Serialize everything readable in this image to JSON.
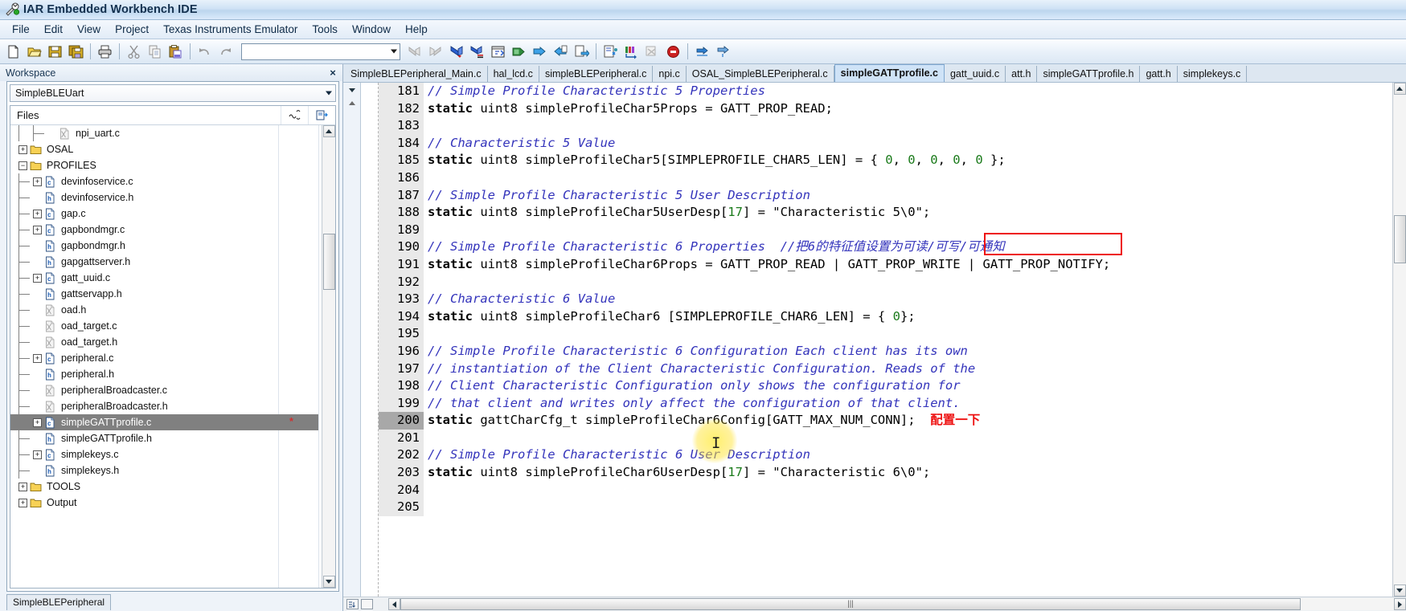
{
  "window": {
    "title": "IAR Embedded Workbench IDE",
    "app_icon": "iar-wrench-icon"
  },
  "menubar": {
    "items": [
      {
        "label": "File"
      },
      {
        "label": "Edit"
      },
      {
        "label": "View"
      },
      {
        "label": "Project"
      },
      {
        "label": "Texas Instruments Emulator"
      },
      {
        "label": "Tools"
      },
      {
        "label": "Window"
      },
      {
        "label": "Help"
      }
    ]
  },
  "toolbar": {
    "combo_value": "",
    "buttons": [
      {
        "name": "new-document-icon"
      },
      {
        "name": "open-folder-icon"
      },
      {
        "name": "save-icon"
      },
      {
        "name": "save-all-icon"
      },
      {
        "name": "print-icon"
      },
      {
        "name": "cut-icon"
      },
      {
        "name": "copy-icon"
      },
      {
        "name": "paste-icon"
      },
      {
        "name": "undo-icon"
      },
      {
        "name": "redo-icon"
      },
      {
        "name": "navigate-back-icon"
      },
      {
        "name": "navigate-forward-icon"
      },
      {
        "name": "go-to-definition-icon"
      },
      {
        "name": "find-in-files-icon"
      },
      {
        "name": "toggle-bookmark-icon"
      },
      {
        "name": "compile-icon"
      },
      {
        "name": "make-icon"
      },
      {
        "name": "rebuild-all-icon"
      },
      {
        "name": "stop-build-icon"
      },
      {
        "name": "debug-without-download-icon"
      },
      {
        "name": "download-and-debug-icon"
      },
      {
        "name": "break-icon"
      },
      {
        "name": "stop-debugging-icon"
      },
      {
        "name": "step-over-icon"
      },
      {
        "name": "step-into-icon"
      }
    ]
  },
  "workspace": {
    "header_label": "Workspace",
    "close_label": "×",
    "selected_workspace": "SimpleBLEUart",
    "files_column_label": "Files",
    "status_tab": "SimpleBLEPeripheral",
    "tree": [
      {
        "label": "npi_uart.c",
        "depth": 3,
        "icon": "excluded-file-icon",
        "expander": "none",
        "connector": "last"
      },
      {
        "label": "OSAL",
        "depth": 1,
        "icon": "folder-icon",
        "expander": "plus",
        "connector": "tee"
      },
      {
        "label": "PROFILES",
        "depth": 1,
        "icon": "folder-icon",
        "expander": "minus",
        "connector": "tee"
      },
      {
        "label": "devinfoservice.c",
        "depth": 2,
        "icon": "c-file-icon",
        "expander": "plus",
        "connector": "tee"
      },
      {
        "label": "devinfoservice.h",
        "depth": 2,
        "icon": "h-file-icon",
        "expander": "none",
        "connector": "tee"
      },
      {
        "label": "gap.c",
        "depth": 2,
        "icon": "c-file-icon",
        "expander": "plus",
        "connector": "tee"
      },
      {
        "label": "gapbondmgr.c",
        "depth": 2,
        "icon": "c-file-icon",
        "expander": "plus",
        "connector": "tee"
      },
      {
        "label": "gapbondmgr.h",
        "depth": 2,
        "icon": "h-file-icon",
        "expander": "none",
        "connector": "tee"
      },
      {
        "label": "gapgattserver.h",
        "depth": 2,
        "icon": "h-file-icon",
        "expander": "none",
        "connector": "tee"
      },
      {
        "label": "gatt_uuid.c",
        "depth": 2,
        "icon": "c-file-icon",
        "expander": "plus",
        "connector": "tee"
      },
      {
        "label": "gattservapp.h",
        "depth": 2,
        "icon": "h-file-icon",
        "expander": "none",
        "connector": "tee"
      },
      {
        "label": "oad.h",
        "depth": 2,
        "icon": "excluded-file-icon",
        "expander": "none",
        "connector": "tee"
      },
      {
        "label": "oad_target.c",
        "depth": 2,
        "icon": "excluded-file-icon",
        "expander": "none",
        "connector": "tee"
      },
      {
        "label": "oad_target.h",
        "depth": 2,
        "icon": "excluded-file-icon",
        "expander": "none",
        "connector": "tee"
      },
      {
        "label": "peripheral.c",
        "depth": 2,
        "icon": "c-file-icon",
        "expander": "plus",
        "connector": "tee"
      },
      {
        "label": "peripheral.h",
        "depth": 2,
        "icon": "h-file-icon",
        "expander": "none",
        "connector": "tee"
      },
      {
        "label": "peripheralBroadcaster.c",
        "depth": 2,
        "icon": "excluded-file-icon",
        "expander": "none",
        "connector": "tee"
      },
      {
        "label": "peripheralBroadcaster.h",
        "depth": 2,
        "icon": "excluded-file-icon",
        "expander": "none",
        "connector": "tee"
      },
      {
        "label": "simpleGATTprofile.c",
        "depth": 2,
        "icon": "c-file-icon",
        "expander": "plus",
        "connector": "tee",
        "selected": true,
        "modified_mark": "*"
      },
      {
        "label": "simpleGATTprofile.h",
        "depth": 2,
        "icon": "h-file-icon",
        "expander": "none",
        "connector": "tee"
      },
      {
        "label": "simplekeys.c",
        "depth": 2,
        "icon": "c-file-icon",
        "expander": "plus",
        "connector": "tee"
      },
      {
        "label": "simplekeys.h",
        "depth": 2,
        "icon": "h-file-icon",
        "expander": "none",
        "connector": "last"
      },
      {
        "label": "TOOLS",
        "depth": 1,
        "icon": "folder-icon",
        "expander": "plus",
        "connector": "tee"
      },
      {
        "label": "Output",
        "depth": 1,
        "icon": "folder-icon",
        "expander": "plus",
        "connector": "last"
      }
    ]
  },
  "editor": {
    "tabs": [
      {
        "label": "SimpleBLEPeripheral_Main.c",
        "active": false
      },
      {
        "label": "hal_lcd.c",
        "active": false
      },
      {
        "label": "simpleBLEPeripheral.c",
        "active": false
      },
      {
        "label": "npi.c",
        "active": false
      },
      {
        "label": "OSAL_SimpleBLEPeripheral.c",
        "active": false
      },
      {
        "label": "simpleGATTprofile.c",
        "active": true
      },
      {
        "label": "gatt_uuid.c",
        "active": false
      },
      {
        "label": "att.h",
        "active": false
      },
      {
        "label": "simpleGATTprofile.h",
        "active": false
      },
      {
        "label": "gatt.h",
        "active": false
      },
      {
        "label": "simplekeys.c",
        "active": false
      }
    ],
    "first_line_number": 181,
    "current_line_number": 200,
    "lines": [
      {
        "n": 181,
        "tokens": [
          {
            "t": "cm",
            "v": "// Simple Profile Characteristic 5 Properties"
          }
        ]
      },
      {
        "n": 182,
        "tokens": [
          {
            "t": "kw",
            "v": "static"
          },
          {
            "t": "pl",
            "v": " uint8 simpleProfileChar5Props = GATT_PROP_READ;"
          }
        ]
      },
      {
        "n": 183,
        "tokens": []
      },
      {
        "n": 184,
        "tokens": [
          {
            "t": "cm",
            "v": "// Characteristic 5 Value"
          }
        ]
      },
      {
        "n": 185,
        "tokens": [
          {
            "t": "kw",
            "v": "static"
          },
          {
            "t": "pl",
            "v": " uint8 simpleProfileChar5[SIMPLEPROFILE_CHAR5_LEN] = { "
          },
          {
            "t": "num",
            "v": "0"
          },
          {
            "t": "pl",
            "v": ", "
          },
          {
            "t": "num",
            "v": "0"
          },
          {
            "t": "pl",
            "v": ", "
          },
          {
            "t": "num",
            "v": "0"
          },
          {
            "t": "pl",
            "v": ", "
          },
          {
            "t": "num",
            "v": "0"
          },
          {
            "t": "pl",
            "v": ", "
          },
          {
            "t": "num",
            "v": "0"
          },
          {
            "t": "pl",
            "v": " };"
          }
        ]
      },
      {
        "n": 186,
        "tokens": []
      },
      {
        "n": 187,
        "tokens": [
          {
            "t": "cm",
            "v": "// Simple Profile Characteristic 5 User Description"
          }
        ]
      },
      {
        "n": 188,
        "tokens": [
          {
            "t": "kw",
            "v": "static"
          },
          {
            "t": "pl",
            "v": " uint8 simpleProfileChar5UserDesp["
          },
          {
            "t": "num",
            "v": "17"
          },
          {
            "t": "pl",
            "v": "] = \"Characteristic 5\\0\";"
          }
        ]
      },
      {
        "n": 189,
        "tokens": []
      },
      {
        "n": 190,
        "tokens": [
          {
            "t": "cm",
            "v": "// Simple Profile Characteristic 6 Properties  //把6的特征值设置为可读/可写/可通知"
          }
        ]
      },
      {
        "n": 191,
        "tokens": [
          {
            "t": "kw",
            "v": "static"
          },
          {
            "t": "pl",
            "v": " uint8 simpleProfileChar6Props = GATT_PROP_READ | GATT_PROP_WRITE | GATT_PROP_NOTIFY;"
          }
        ]
      },
      {
        "n": 192,
        "tokens": []
      },
      {
        "n": 193,
        "tokens": [
          {
            "t": "cm",
            "v": "// Characteristic 6 Value"
          }
        ]
      },
      {
        "n": 194,
        "tokens": [
          {
            "t": "kw",
            "v": "static"
          },
          {
            "t": "pl",
            "v": " uint8 simpleProfileChar6 [SIMPLEPROFILE_CHAR6_LEN] = { "
          },
          {
            "t": "num",
            "v": "0"
          },
          {
            "t": "pl",
            "v": "};"
          }
        ]
      },
      {
        "n": 195,
        "tokens": []
      },
      {
        "n": 196,
        "tokens": [
          {
            "t": "cm",
            "v": "// Simple Profile Characteristic 6 Configuration Each client has its own"
          }
        ]
      },
      {
        "n": 197,
        "tokens": [
          {
            "t": "cm",
            "v": "// instantiation of the Client Characteristic Configuration. Reads of the"
          }
        ]
      },
      {
        "n": 198,
        "tokens": [
          {
            "t": "cm",
            "v": "// Client Characteristic Configuration only shows the configuration for"
          }
        ]
      },
      {
        "n": 199,
        "tokens": [
          {
            "t": "cm",
            "v": "// that client and writes only affect the configuration of that client."
          }
        ]
      },
      {
        "n": 200,
        "tokens": [
          {
            "t": "kw",
            "v": "static"
          },
          {
            "t": "pl",
            "v": " gattCharCfg_t simpleProfileChar6Config[GATT_MAX_NUM_CONN];  "
          },
          {
            "t": "anno",
            "v": "配置一下"
          }
        ]
      },
      {
        "n": 201,
        "tokens": []
      },
      {
        "n": 202,
        "tokens": [
          {
            "t": "cm",
            "v": "// Simple Profile Characteristic 6 User Description"
          }
        ]
      },
      {
        "n": 203,
        "tokens": [
          {
            "t": "kw",
            "v": "static"
          },
          {
            "t": "pl",
            "v": " uint8 simpleProfileChar6UserDesp["
          },
          {
            "t": "num",
            "v": "17"
          },
          {
            "t": "pl",
            "v": "] = \"Characteristic 6\\0\";"
          }
        ]
      },
      {
        "n": 204,
        "tokens": []
      },
      {
        "n": 205,
        "tokens": []
      }
    ],
    "annotations": [
      {
        "name": "red-highlight-box",
        "text": "可读/可写/可通知",
        "color": "#ee1111",
        "line": 190
      },
      {
        "name": "red-text-note",
        "text": "配置一下",
        "color": "#ee1111",
        "line": 200
      }
    ],
    "hscroll_grip": "|||"
  },
  "colors": {
    "comment": "#3333bb",
    "number": "#1a7a1a",
    "annotation_red": "#ee1111",
    "selection_gray": "#808080",
    "current_line_gutter": "#a8a8a8",
    "titlebar_blue": "#bcd6ee"
  }
}
